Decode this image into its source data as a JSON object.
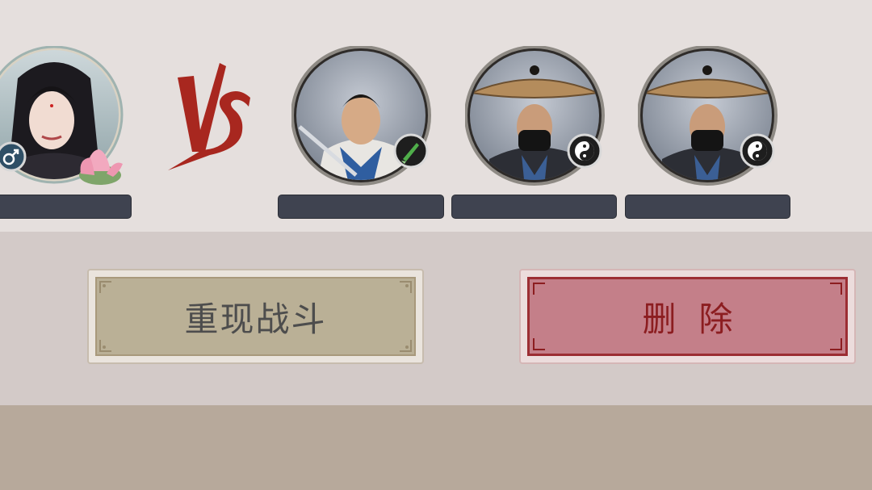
{
  "battle": {
    "vs_text": "VS",
    "player_team": [
      {
        "role": "heroine",
        "badge_icon": "male-symbol-icon"
      }
    ],
    "enemy_team": [
      {
        "role": "swordsman",
        "badge_icon": "jade-blade-icon"
      },
      {
        "role": "masked-straw-hat-warrior",
        "badge_icon": "yin-yang-icon"
      },
      {
        "role": "masked-straw-hat-warrior",
        "badge_icon": "yin-yang-icon"
      }
    ]
  },
  "actions": {
    "replay_label": "重现战斗",
    "delete_label": "删除"
  },
  "colors": {
    "name_bar": "#3f4350",
    "vs_red": "#a8271f",
    "replay_button": "#bab096",
    "delete_button": "#c47f89",
    "delete_border": "#9c2d33"
  }
}
